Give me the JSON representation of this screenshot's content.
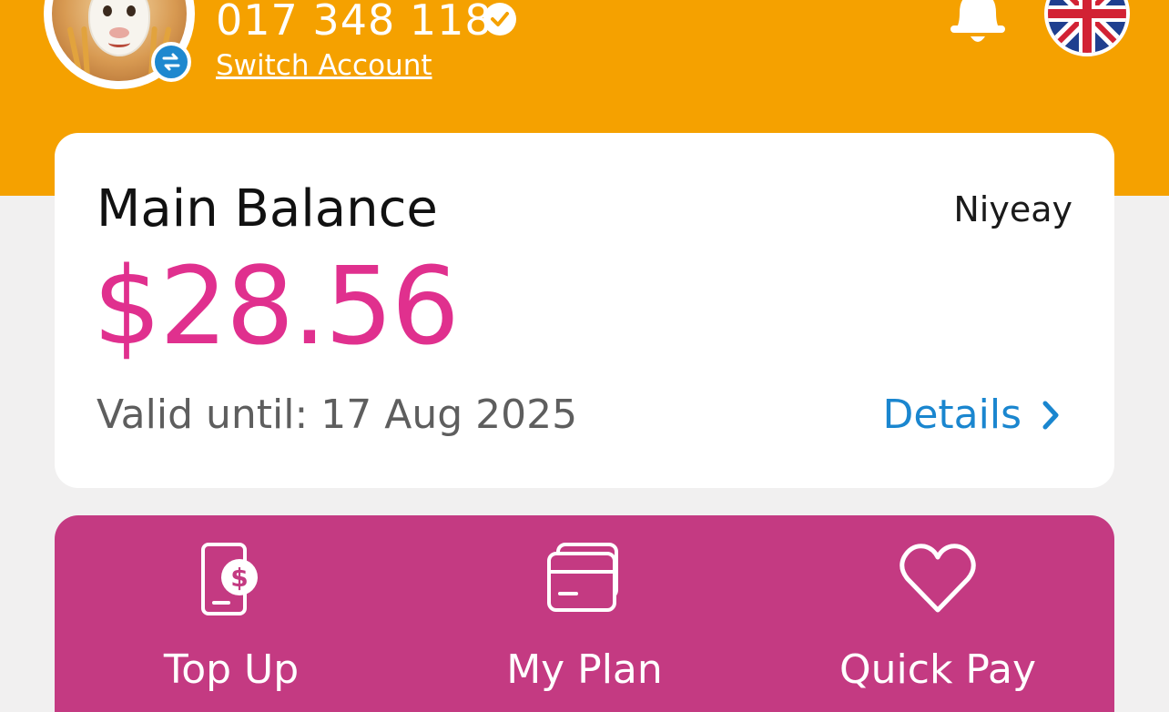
{
  "header": {
    "phone_number": "017 348 118",
    "switch_account_label": "Switch Account"
  },
  "balance": {
    "title": "Main Balance",
    "provider": "Niyeay",
    "amount": "$28.56",
    "valid_until": "Valid until: 17 Aug 2025",
    "details_label": "Details"
  },
  "actions": [
    {
      "label": "Top Up",
      "icon": "phone-dollar-icon"
    },
    {
      "label": "My Plan",
      "icon": "card-stack-icon"
    },
    {
      "label": "Quick Pay",
      "icon": "heart-icon"
    }
  ],
  "colors": {
    "header_bg": "#f5a100",
    "accent_pink": "#e0308e",
    "action_bar_bg": "#c43a82",
    "link_blue": "#1a86cf",
    "page_bg": "#f1f0f0"
  }
}
